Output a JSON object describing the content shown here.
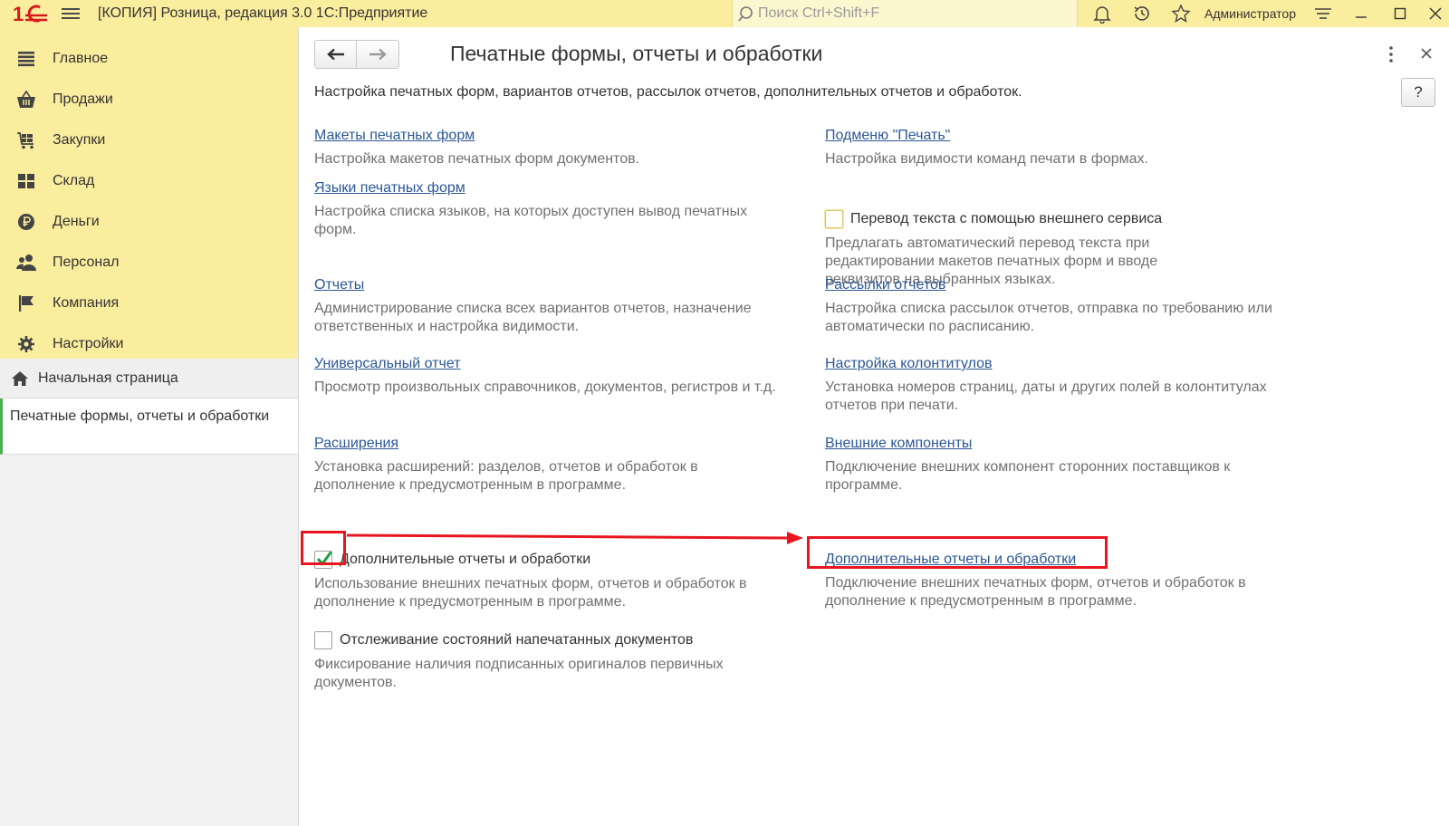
{
  "window": {
    "title": "[КОПИЯ] Розница, редакция 3.0 1С:Предприятие",
    "search_placeholder": "Поиск Ctrl+Shift+F",
    "user": "Администратор",
    "logo_text": "1С"
  },
  "sidebar": {
    "sections": [
      {
        "label": "Главное",
        "icon": "menu-lines-icon"
      },
      {
        "label": "Продажи",
        "icon": "basket-icon"
      },
      {
        "label": "Закупки",
        "icon": "cart-icon"
      },
      {
        "label": "Склад",
        "icon": "warehouse-icon"
      },
      {
        "label": "Деньги",
        "icon": "ruble-icon"
      },
      {
        "label": "Персонал",
        "icon": "people-icon"
      },
      {
        "label": "Компания",
        "icon": "flag-icon"
      },
      {
        "label": "Настройки",
        "icon": "gear-icon"
      }
    ],
    "home": "Начальная страница",
    "open_form": "Печатные формы, отчеты и обработки"
  },
  "form": {
    "title": "Печатные формы, отчеты и обработки",
    "description": "Настройка печатных форм, вариантов отчетов, рассылок отчетов, дополнительных отчетов и обработок.",
    "help_label": "?",
    "left": {
      "layouts": {
        "link": "Макеты печатных форм",
        "desc": "Настройка макетов печатных форм документов."
      },
      "languages": {
        "link": "Языки печатных форм",
        "desc": "Настройка списка языков, на которых доступен вывод печатных форм."
      },
      "reports": {
        "link": "Отчеты",
        "desc": "Администрирование списка всех вариантов отчетов, назначение ответственных и настройка видимости."
      },
      "universal": {
        "link": "Универсальный отчет",
        "desc": "Просмотр произвольных справочников, документов, регистров и т.д."
      },
      "extensions": {
        "link": "Расширения",
        "desc": "Установка расширений: разделов, отчетов и обработок в дополнение к предусмотренным в программе."
      },
      "additional": {
        "label": "Дополнительные отчеты и обработки",
        "checked": true,
        "desc": "Использование внешних печатных форм, отчетов и обработок в дополнение к предусмотренным в программе."
      },
      "tracking": {
        "label": "Отслеживание состояний напечатанных документов",
        "checked": false,
        "desc": "Фиксирование наличия подписанных оригиналов первичных документов."
      }
    },
    "right": {
      "print_submenu": {
        "link": "Подменю \"Печать\"",
        "desc": "Настройка видимости команд печати в формах."
      },
      "translation": {
        "label": "Перевод текста с помощью внешнего сервиса",
        "checked": false,
        "desc": "Предлагать автоматический перевод текста при редактировании макетов печатных форм и вводе реквизитов на выбранных языках."
      },
      "mailing": {
        "link": "Рассылки отчетов",
        "desc": "Настройка списка рассылок отчетов, отправка по требованию или автоматически по расписанию."
      },
      "headers": {
        "link": "Настройка колонтитулов",
        "desc": "Установка номеров страниц, даты и других полей в колонтитулах отчетов при печати."
      },
      "components": {
        "link": "Внешние компоненты",
        "desc": "Подключение внешних компонент сторонних поставщиков к программе."
      },
      "additional": {
        "link": "Дополнительные отчеты и обработки",
        "desc": "Подключение внешних печатных форм, отчетов и обработок в дополнение к предусмотренным в программе."
      }
    }
  },
  "colors": {
    "topbar": "#fbed9e",
    "link": "#2b5797",
    "annotation": "#e8161f",
    "checkmark": "#1e9e3e"
  }
}
